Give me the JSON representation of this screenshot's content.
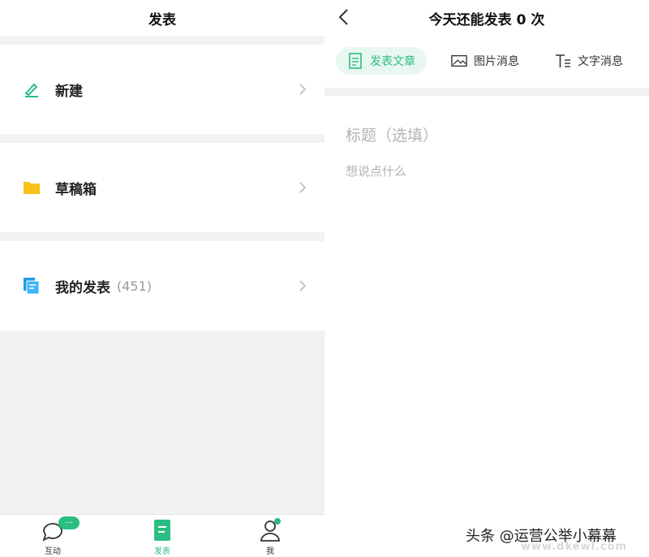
{
  "left": {
    "title": "发表",
    "menu": [
      {
        "label": "新建",
        "icon": "pencil-icon"
      },
      {
        "label": "草稿箱",
        "icon": "folder-icon"
      },
      {
        "label": "我的发表",
        "count": "(451)",
        "icon": "documents-icon"
      }
    ],
    "tabbar": [
      {
        "label": "互动",
        "icon": "chat-bubble-icon",
        "badge": "…"
      },
      {
        "label": "发表",
        "icon": "post-icon",
        "active": true
      },
      {
        "label": "我",
        "icon": "user-icon"
      }
    ]
  },
  "right": {
    "title": "今天还能发表 0 次",
    "type_tabs": [
      {
        "label": "发表文章",
        "icon": "article-icon",
        "active": true
      },
      {
        "label": "图片消息",
        "icon": "image-icon"
      },
      {
        "label": "文字消息",
        "icon": "text-icon"
      }
    ],
    "title_placeholder": "标题（选填）",
    "body_placeholder": "想说点什么",
    "watermark": "头条 @运营公举小幕幕",
    "watermark_site": "www.dkewl.com"
  },
  "colors": {
    "accent": "#2bbd83",
    "folder": "#f7c21a",
    "docs": "#1e9be9"
  }
}
